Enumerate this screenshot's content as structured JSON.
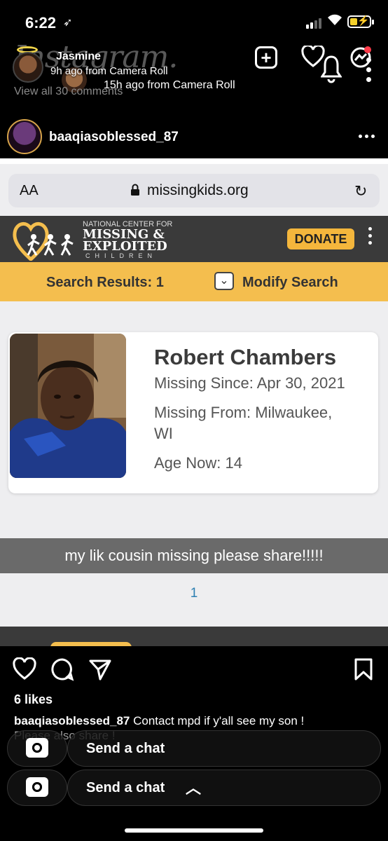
{
  "status_bar": {
    "time": "6:22",
    "location_icon": "location-arrow-icon",
    "battery_color": "#f4d02b"
  },
  "story_overlay": {
    "ghost_title": "Instagram.",
    "name": "Jasmine",
    "subtitle_1": "9h ago from Camera Roll",
    "subtitle_2": "15h ago from Camera Roll",
    "view_all": "View all 30 comments"
  },
  "post": {
    "username": "baaqiasoblessed_87",
    "likes": "6 likes",
    "caption_user": "baaqiasoblessed_87",
    "caption_text": "Contact mpd if y'all see my son !",
    "caption_more": "Please also share !"
  },
  "embedded_screenshot": {
    "browser": {
      "aa_label": "AA",
      "url": "missingkids.org"
    },
    "site_header": {
      "org_line1": "NATIONAL CENTER FOR",
      "org_line2a": "MISSING &",
      "org_line2b": "EXPLOITED",
      "org_line3": "CHILDREN",
      "donate": "DONATE",
      "accent": "#f4be4e"
    },
    "results": {
      "count_label": "Search Results: 1",
      "modify_label": "Modify Search"
    },
    "card": {
      "name": "Robert Chambers",
      "missing_since": "Missing Since: Apr 30, 2021",
      "missing_from_1": "Missing From: Milwaukee,",
      "missing_from_2": "WI",
      "age_now": "Age Now: 14"
    },
    "caption_overlay": "my lik cousin missing please share!!!!!",
    "page_number": "1"
  },
  "chat_bars": [
    {
      "label": "Send a chat"
    },
    {
      "label": "Send a chat"
    }
  ]
}
